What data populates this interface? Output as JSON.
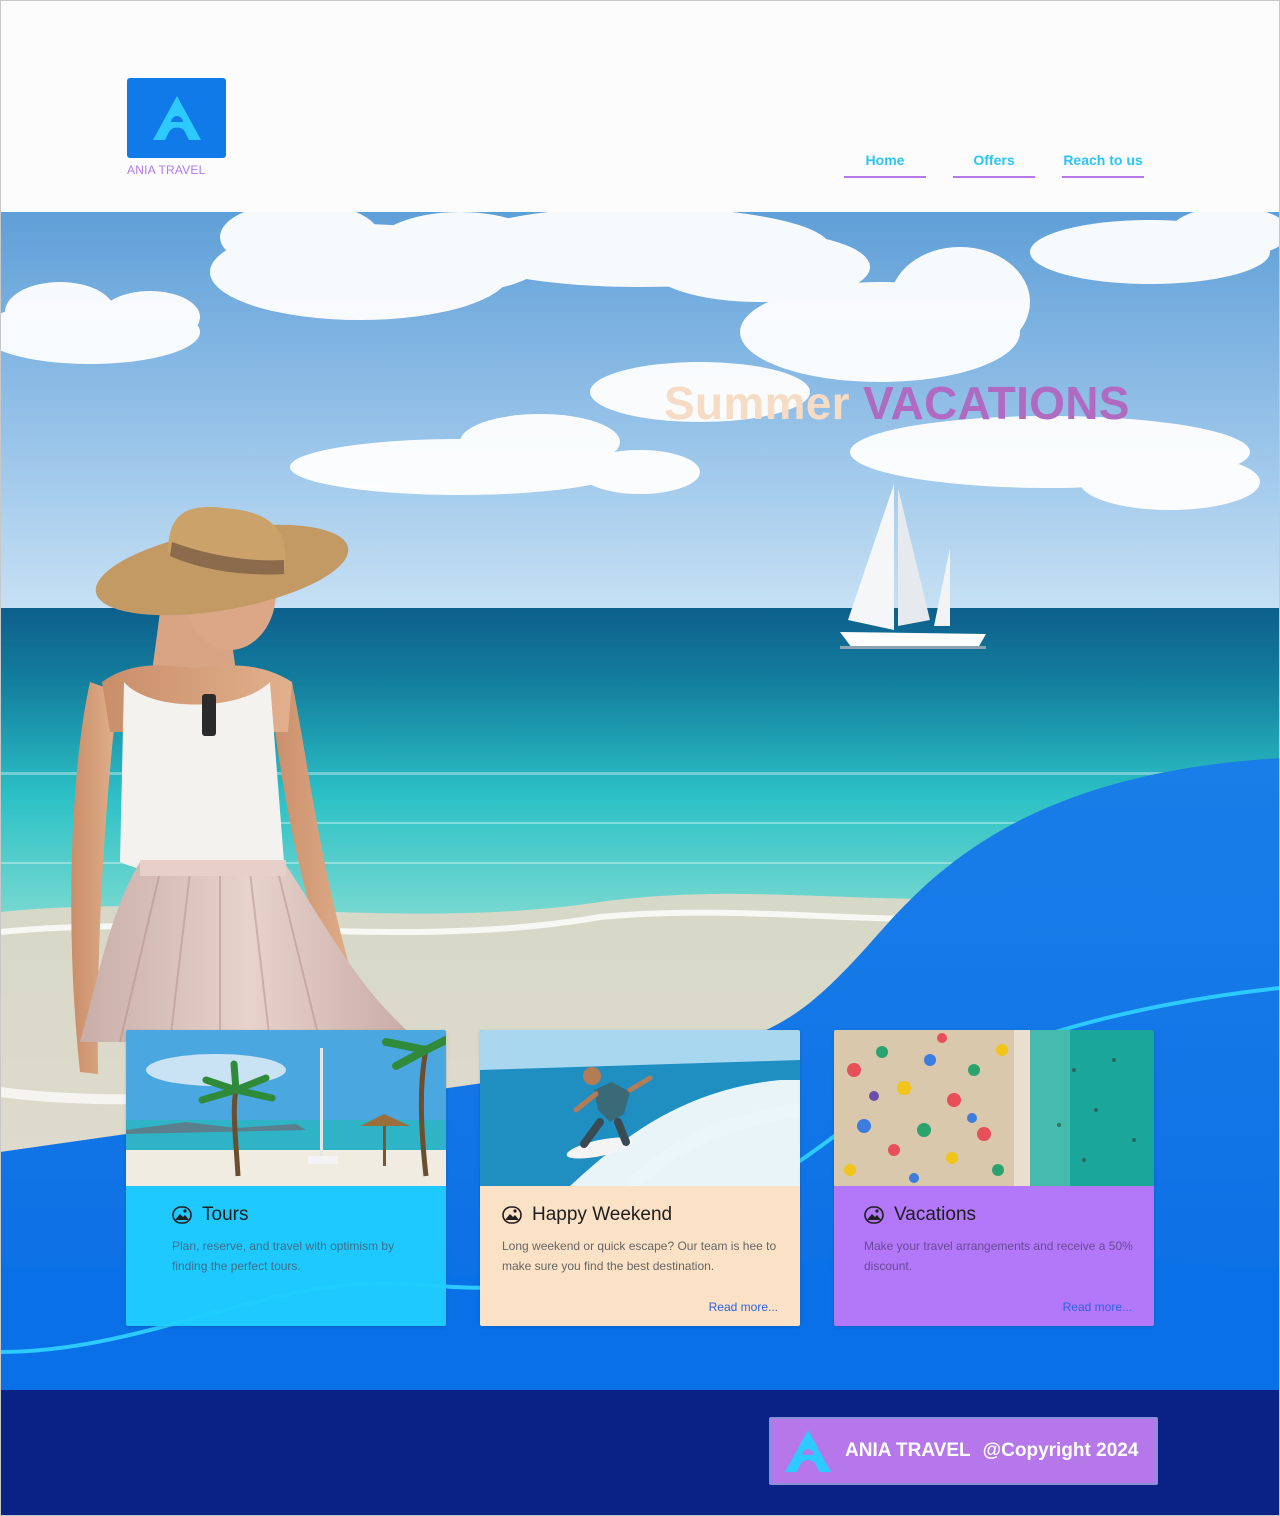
{
  "header": {
    "logo_text": "ANIA TRAVEL",
    "nav": [
      {
        "label": "Home"
      },
      {
        "label": "Offers"
      },
      {
        "label": "Reach to us"
      }
    ]
  },
  "hero": {
    "title_word1": "Summer",
    "title_word2": "VACATIONS"
  },
  "cards": [
    {
      "title": "Tours",
      "text": "Plan, reserve, and travel  with optimism by finding the perfect tours.",
      "icon": "landscape-icon"
    },
    {
      "title": "Happy Weekend",
      "text": "Long weekend or quick escape? Our team is hee to make sure you find the best destination.",
      "link": "Read more...",
      "icon": "landscape-icon"
    },
    {
      "title": "Vacations",
      "text": "Make your travel arrangements and receive a 50% discount.",
      "link": "Read more...",
      "icon": "landscape-icon"
    }
  ],
  "footer": {
    "brand": "ANIA TRAVEL",
    "copyright": "@Copyright 2024"
  },
  "colors": {
    "primary_blue": "#0f7ae8",
    "accent_purple": "#b677ea",
    "nav_cyan": "#29c5f6",
    "footer_navy": "#0a2185",
    "title_peach": "#f6dcc4",
    "title_mauve": "#b06ac2"
  }
}
